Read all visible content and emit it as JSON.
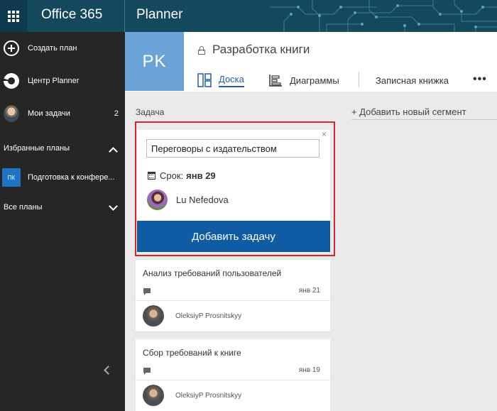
{
  "topbar": {
    "brand": "Office 365",
    "app_name": "Planner",
    "waffle_icon": "app-launcher-icon",
    "colors": {
      "bar": "#14485c",
      "launcher": "#0d3a4d"
    }
  },
  "sidebar": {
    "create_plan": "Создать план",
    "hub": "Центр Planner",
    "my_tasks": "Мои задачи",
    "my_tasks_count": "2",
    "favorites_heading": "Избранные планы",
    "favorite_plans": [
      {
        "badge": "ПК",
        "label": "Подготовка к конфере..."
      }
    ],
    "all_plans_heading": "Все планы"
  },
  "plan": {
    "initials": "PK",
    "title": "Разработка книги",
    "tabs": {
      "board": "Доска",
      "charts": "Диаграммы",
      "notebook": "Записная книжка"
    },
    "more": "•••"
  },
  "board": {
    "bucket_title": "Задача",
    "add_bucket": "+ Добавить новый сегмент",
    "new_task": {
      "close": "×",
      "name_value": "Переговоры с издательством",
      "due_label": "Срок:",
      "due_value": "янв 29",
      "assignee": "Lu Nefedova",
      "add_button": "Добавить задачу"
    },
    "cards": [
      {
        "title": "Анализ требований пользователей",
        "date": "янв 21",
        "person": "OleksiyP Prosnitskyy"
      },
      {
        "title": "Сбор требований к книге",
        "date": "янв 19",
        "person": "OleksiyP Prosnitskyy"
      }
    ]
  },
  "accent_colors": {
    "primary_button": "#0f5ba4",
    "highlight_border": "#d9232e",
    "plan_tile": "#6aa3d8",
    "active_tab": "#1e5ea8"
  }
}
